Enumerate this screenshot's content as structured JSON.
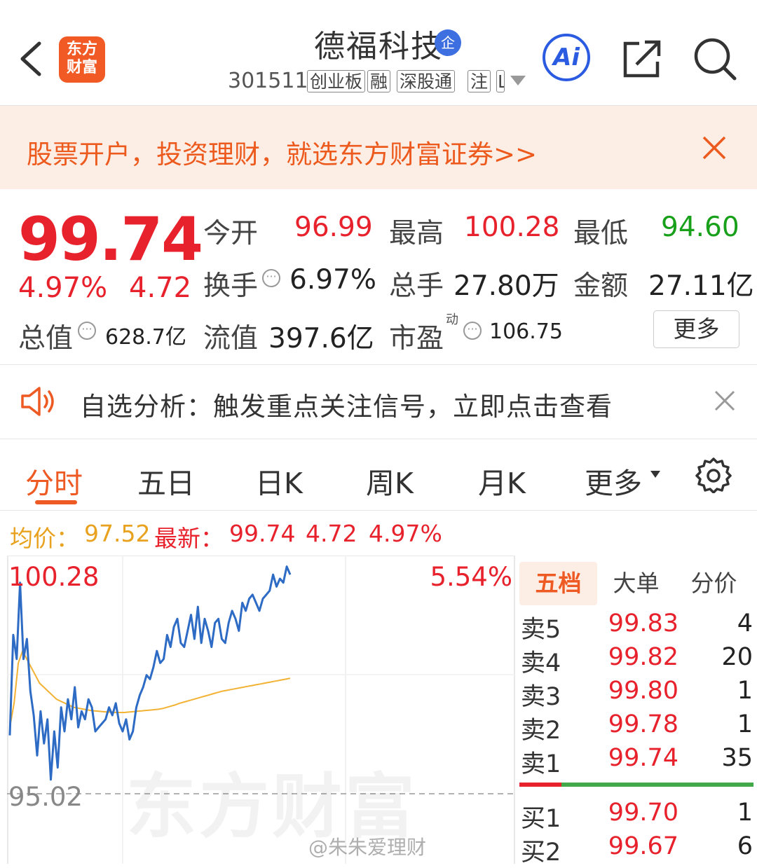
{
  "header": {
    "logo_line1": "东方",
    "logo_line2": "财富",
    "stock_name": "德福科技",
    "badge": "企",
    "stock_code": "301511",
    "tags": [
      "创业板",
      "融",
      "深股通",
      "注",
      "L"
    ],
    "ai_label": "Ai",
    "icons": [
      "back-icon",
      "share-icon",
      "search-icon"
    ]
  },
  "promo": {
    "text": "股票开户，投资理财，就选东方财富证券>>"
  },
  "quote": {
    "price": "99.74",
    "change_pct": "4.97%",
    "change_amt": "4.72",
    "open_label": "今开",
    "open": "96.99",
    "high_label": "最高",
    "high": "100.28",
    "low_label": "最低",
    "low": "94.60",
    "turnover_label": "换手",
    "turnover": "6.97%",
    "volume_label": "总手",
    "volume": "27.80万",
    "amount_label": "金额",
    "amount": "27.11亿",
    "mktcap_label": "总值",
    "mktcap": "628.7亿",
    "float_label": "流值",
    "float": "397.6亿",
    "pe_label": "市盈",
    "pe_sup": "动",
    "pe": "106.75",
    "more": "更多"
  },
  "notice": {
    "text": "自选分析：触发重点关注信号，立即点击查看"
  },
  "tabs": {
    "items": [
      "分时",
      "五日",
      "日K",
      "周K",
      "月K",
      "更多"
    ],
    "active": "分时"
  },
  "avg_line": {
    "avg_label": "均价：",
    "avg_value": "97.52",
    "latest_label": "最新：",
    "latest_value": "99.74",
    "latest_chg": "4.72",
    "latest_pct": "4.97%"
  },
  "chart_data": {
    "type": "line",
    "y_top_label": "100.28",
    "y_bottom_label": "95.02",
    "pct_top_label": "5.54%",
    "ylim": [
      94.3,
      100.4
    ],
    "watermark": "东方财富",
    "credit": "@朱朱爱理财",
    "colors": {
      "price": "#2d6bc4",
      "avg": "#f2b233"
    },
    "series": [
      {
        "values": [
          96.1,
          98.6,
          98.0,
          99.9,
          98.0,
          98.5,
          97.2,
          96.6,
          95.6,
          96.7,
          95.9,
          96.5,
          95.0,
          96.2,
          95.3,
          96.8,
          96.2,
          97.0,
          96.5,
          97.3,
          96.3,
          96.7,
          96.5,
          97.0,
          96.8,
          96.2,
          96.3,
          96.4,
          96.5,
          96.8,
          96.6,
          96.9,
          96.4,
          96.2,
          96.5,
          96.0,
          96.2,
          96.8,
          97.1,
          97.3,
          97.6,
          97.5,
          97.8,
          98.2,
          97.9,
          98.0,
          98.6,
          98.3,
          98.8,
          99.0,
          98.4,
          98.3,
          98.7,
          99.1,
          98.5,
          99.3,
          98.4,
          99.0,
          98.7,
          98.3,
          98.9,
          99.0,
          98.5,
          98.4,
          98.9,
          99.2,
          99.0,
          98.7,
          99.4,
          99.2,
          99.5,
          99.6,
          99.4,
          99.2,
          99.5,
          99.6,
          99.7,
          100.1,
          99.8,
          100.0,
          99.9,
          100.3,
          100.1
        ]
      },
      {
        "values": [
          96.3,
          96.9,
          97.9,
          98.2,
          98.0,
          97.8,
          97.6,
          97.4,
          97.3,
          97.2,
          97.1,
          97.0,
          96.95,
          96.9,
          96.85,
          96.8,
          96.78,
          96.76,
          96.74,
          96.72,
          96.71,
          96.7,
          96.69,
          96.68,
          96.68,
          96.67,
          96.67,
          96.67,
          96.68,
          96.69,
          96.7,
          96.71,
          96.72,
          96.73,
          96.74,
          96.75,
          96.77,
          96.8,
          96.83,
          96.86,
          96.9,
          96.93,
          96.96,
          96.99,
          97.02,
          97.05,
          97.08,
          97.11,
          97.14,
          97.17,
          97.2,
          97.22,
          97.24,
          97.26,
          97.28,
          97.3,
          97.32,
          97.34,
          97.36,
          97.38,
          97.4,
          97.42,
          97.44,
          97.46,
          97.48,
          97.5,
          97.52
        ]
      }
    ]
  },
  "order_book": {
    "tabs": [
      "五档",
      "大单",
      "分价"
    ],
    "asks": [
      {
        "label": "卖5",
        "price": "99.83",
        "vol": "4"
      },
      {
        "label": "卖4",
        "price": "99.82",
        "vol": "20"
      },
      {
        "label": "卖3",
        "price": "99.80",
        "vol": "1"
      },
      {
        "label": "卖2",
        "price": "99.78",
        "vol": "1"
      },
      {
        "label": "卖1",
        "price": "99.74",
        "vol": "35"
      }
    ],
    "bids": [
      {
        "label": "买1",
        "price": "99.70",
        "vol": "1"
      },
      {
        "label": "买2",
        "price": "99.67",
        "vol": "6"
      }
    ]
  }
}
